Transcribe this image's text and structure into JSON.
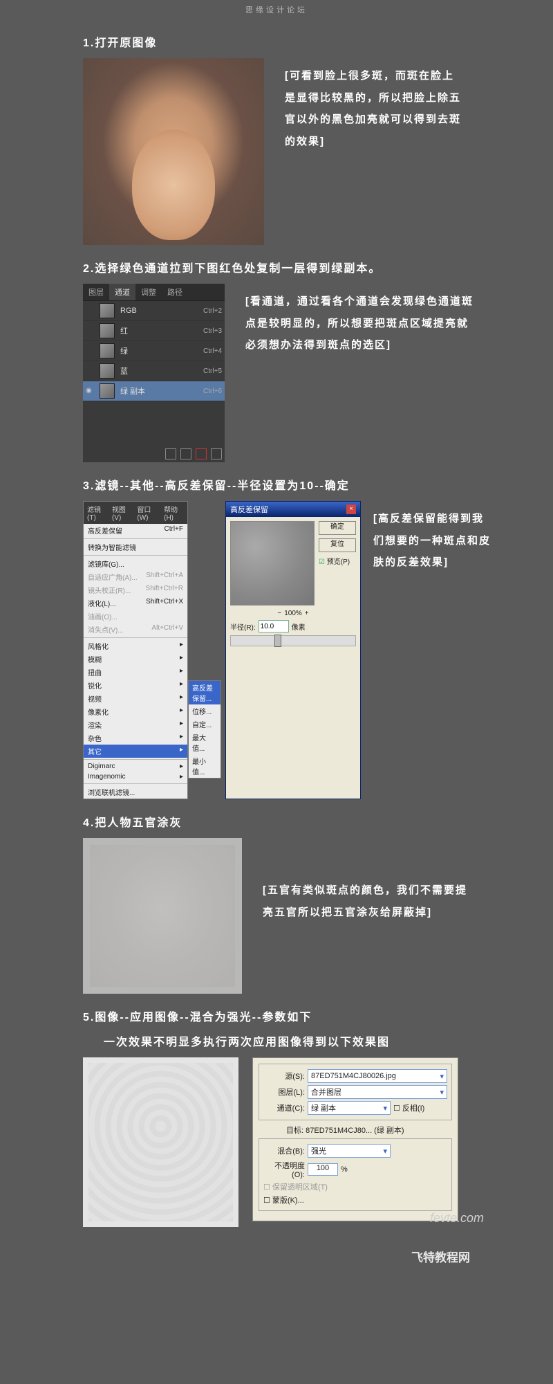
{
  "site_header": "思缘设计论坛",
  "step1": {
    "title": "1.打开原图像",
    "caption": "[可看到脸上很多斑，而斑在脸上是显得比较黑的，所以把脸上除五官以外的黑色加亮就可以得到去斑的效果]"
  },
  "step2": {
    "title": "2.选择绿色通道拉到下图红色处复制一层得到绿副本。",
    "caption": "[看通道，通过看各个通道会发现绿色通道斑点是较明显的，所以想要把斑点区域提亮就必须想办法得到斑点的选区]",
    "tabs": [
      "图层",
      "通道",
      "调整",
      "路径"
    ],
    "channels": [
      {
        "name": "RGB",
        "key": "Ctrl+2"
      },
      {
        "name": "红",
        "key": "Ctrl+3"
      },
      {
        "name": "绿",
        "key": "Ctrl+4"
      },
      {
        "name": "蓝",
        "key": "Ctrl+5"
      },
      {
        "name": "绿 副本",
        "key": "Ctrl+6"
      }
    ]
  },
  "step3": {
    "title": "3.滤镜--其他--高反差保留--半径设置为10--确定",
    "caption": "[高反差保留能得到我们想要的一种斑点和皮肤的反差效果]",
    "menubar": [
      "滤镜(T)",
      "视图(V)",
      "窗口(W)",
      "帮助(H)"
    ],
    "menu": {
      "last": {
        "label": "高反差保留",
        "key": "Ctrl+F"
      },
      "smart": "转换为智能滤镜",
      "gallery": "滤镜库(G)...",
      "adaptive": {
        "label": "自适应广角(A)...",
        "key": "Shift+Ctrl+A"
      },
      "lens": {
        "label": "镜头校正(R)...",
        "key": "Shift+Ctrl+R"
      },
      "liquify": {
        "label": "液化(L)...",
        "key": "Shift+Ctrl+X"
      },
      "oil": "油画(O)...",
      "vanish": {
        "label": "消失点(V)...",
        "key": "Alt+Ctrl+V"
      },
      "groups": [
        "风格化",
        "模糊",
        "扭曲",
        "锐化",
        "视频",
        "像素化",
        "渲染",
        "杂色",
        "其它"
      ],
      "digimarc": "Digimarc",
      "imagenomic": "Imagenomic",
      "browse": "浏览联机滤镜..."
    },
    "submenu": [
      "高反差保留...",
      "位移...",
      "自定...",
      "最大值...",
      "最小值..."
    ],
    "dialog": {
      "title": "高反差保留",
      "ok": "确定",
      "cancel": "复位",
      "preview": "预览(P)",
      "zoom_minus": "−",
      "zoom_pct": "100%",
      "zoom_plus": "+",
      "radius_label": "半径(R):",
      "radius_value": "10.0",
      "radius_unit": "像素"
    }
  },
  "step4": {
    "title": "4.把人物五官涂灰",
    "caption": "[五官有类似斑点的颜色，我们不需要提亮五官所以把五官涂灰给屏蔽掉]"
  },
  "step5": {
    "title": "5.图像--应用图像--混合为强光--参数如下",
    "subtitle": "一次效果不明显多执行两次应用图像得到以下效果图",
    "src_label": "源(S):",
    "src_val": "87ED751M4CJ80026.jpg",
    "layer_label": "图层(L):",
    "layer_val": "合并图层",
    "channel_label": "通道(C):",
    "channel_val": "绿 副本",
    "invert": "反相(I)",
    "target_label": "目标:",
    "target_val": "87ED751M4CJ80... (绿 副本)",
    "blend_label": "混合(B):",
    "blend_val": "强光",
    "opacity_label": "不透明度(O):",
    "opacity_val": "100",
    "opacity_unit": "%",
    "preserve": "保留透明区域(T)",
    "mask": "蒙版(K)...",
    "watermark": "fevte.com"
  },
  "footer": "飞特教程网"
}
